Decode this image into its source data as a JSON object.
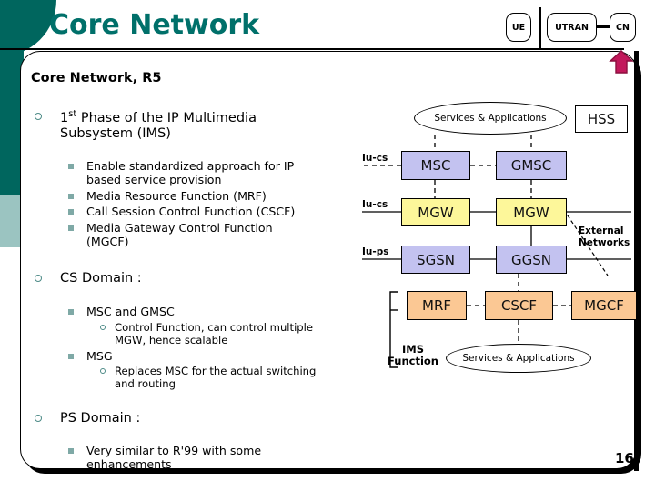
{
  "slide": {
    "title": "Core Network",
    "subtitle": "Core Network, R5",
    "page_number": "16"
  },
  "header_diagram": {
    "boxes": [
      {
        "id": "ue",
        "label": "UE"
      },
      {
        "id": "utran",
        "label": "UTRAN"
      },
      {
        "id": "cn",
        "label": "CN"
      }
    ],
    "arrow_color": "#c2185b",
    "arrow_target": "CN"
  },
  "colors": {
    "title_teal": "#00706a",
    "band_dark": "#00665e",
    "band_light": "#9bc4c1",
    "bullet_teal": "#7fa9a6",
    "box_purple": "#c3c2f0",
    "box_yellow": "#fdf79a",
    "box_peach": "#fbc894",
    "accent_magenta": "#c2185b"
  },
  "bullets": [
    {
      "level": 1,
      "text_html": "1<sup>st</sup> Phase of the IP Multimedia",
      "line1": "1st Phase of the IP Multimedia",
      "line2": "Subsystem (IMS)"
    },
    {
      "level": 2,
      "line1": "Enable standardized approach for IP",
      "line2": "based service provision"
    },
    {
      "level": 2,
      "line1": "Media Resource Function (MRF)"
    },
    {
      "level": 2,
      "line1": "Call Session Control Function (CSCF)"
    },
    {
      "level": 2,
      "line1": "Media Gateway Control Function",
      "line2": "(MGCF)"
    },
    {
      "level": 1,
      "line1": "CS Domain :"
    },
    {
      "level": 2,
      "line1": "MSC and GMSC"
    },
    {
      "level": 3,
      "line1": "Control Function, can control multiple",
      "line2": "MGW, hence scalable"
    },
    {
      "level": 2,
      "line1": "MSG"
    },
    {
      "level": 3,
      "line1": "Replaces MSC for the actual switching",
      "line2": "and routing"
    },
    {
      "level": 1,
      "line1": "PS Domain :"
    },
    {
      "level": 2,
      "line1": "Very similar to R'99 with some",
      "line2": "enhancements"
    }
  ],
  "network_diagram": {
    "nodes": {
      "services_top": "Services & Applications",
      "services_bottom": "Services & Applications",
      "hss": "HSS",
      "msc": "MSC",
      "gmsc": "GMSC",
      "mgw_left": "MGW",
      "mgw_right": "MGW",
      "sgsn": "SGSN",
      "ggsn": "GGSN",
      "mrf": "MRF",
      "cscf": "CSCF",
      "mgcf": "MGCF"
    },
    "interfaces": {
      "iu_cs_msc": "Iu-cs",
      "iu_cs_mgw": "Iu-cs",
      "iu_ps_sgsn": "Iu-ps"
    },
    "annotations": {
      "external_networks_line1": "External",
      "external_networks_line2": "Networks",
      "ims_function_line1": "IMS",
      "ims_function_line2": "Function"
    }
  }
}
